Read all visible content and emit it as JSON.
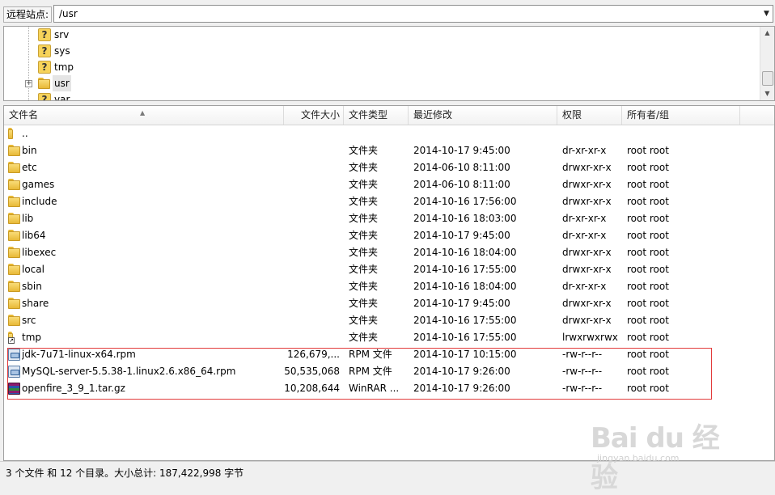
{
  "site_bar": {
    "label": "远程站点:",
    "path": "/usr"
  },
  "tree": {
    "items": [
      {
        "label": "srv",
        "icon": "question-folder-icon",
        "expandable": false
      },
      {
        "label": "sys",
        "icon": "question-folder-icon",
        "expandable": false
      },
      {
        "label": "tmp",
        "icon": "question-folder-icon",
        "expandable": false
      },
      {
        "label": "usr",
        "icon": "folder-icon",
        "expandable": true,
        "selected": true
      },
      {
        "label": "var",
        "icon": "question-folder-icon",
        "expandable": false
      }
    ]
  },
  "file_list": {
    "columns": {
      "name": "文件名",
      "size": "文件大小",
      "type": "文件类型",
      "modified": "最近修改",
      "permissions": "权限",
      "owner": "所有者/组"
    },
    "rows": [
      {
        "name": "..",
        "size": "",
        "type": "",
        "modified": "",
        "permissions": "",
        "owner": "",
        "icon": "folder-icon"
      },
      {
        "name": "bin",
        "size": "",
        "type": "文件夹",
        "modified": "2014-10-17 9:45:00",
        "permissions": "dr-xr-xr-x",
        "owner": "root root",
        "icon": "folder-icon"
      },
      {
        "name": "etc",
        "size": "",
        "type": "文件夹",
        "modified": "2014-06-10 8:11:00",
        "permissions": "drwxr-xr-x",
        "owner": "root root",
        "icon": "folder-icon"
      },
      {
        "name": "games",
        "size": "",
        "type": "文件夹",
        "modified": "2014-06-10 8:11:00",
        "permissions": "drwxr-xr-x",
        "owner": "root root",
        "icon": "folder-icon"
      },
      {
        "name": "include",
        "size": "",
        "type": "文件夹",
        "modified": "2014-10-16 17:56:00",
        "permissions": "drwxr-xr-x",
        "owner": "root root",
        "icon": "folder-icon"
      },
      {
        "name": "lib",
        "size": "",
        "type": "文件夹",
        "modified": "2014-10-16 18:03:00",
        "permissions": "dr-xr-xr-x",
        "owner": "root root",
        "icon": "folder-icon"
      },
      {
        "name": "lib64",
        "size": "",
        "type": "文件夹",
        "modified": "2014-10-17 9:45:00",
        "permissions": "dr-xr-xr-x",
        "owner": "root root",
        "icon": "folder-icon"
      },
      {
        "name": "libexec",
        "size": "",
        "type": "文件夹",
        "modified": "2014-10-16 18:04:00",
        "permissions": "drwxr-xr-x",
        "owner": "root root",
        "icon": "folder-icon"
      },
      {
        "name": "local",
        "size": "",
        "type": "文件夹",
        "modified": "2014-10-16 17:55:00",
        "permissions": "drwxr-xr-x",
        "owner": "root root",
        "icon": "folder-icon"
      },
      {
        "name": "sbin",
        "size": "",
        "type": "文件夹",
        "modified": "2014-10-16 18:04:00",
        "permissions": "dr-xr-xr-x",
        "owner": "root root",
        "icon": "folder-icon"
      },
      {
        "name": "share",
        "size": "",
        "type": "文件夹",
        "modified": "2014-10-17 9:45:00",
        "permissions": "drwxr-xr-x",
        "owner": "root root",
        "icon": "folder-icon"
      },
      {
        "name": "src",
        "size": "",
        "type": "文件夹",
        "modified": "2014-10-16 17:55:00",
        "permissions": "drwxr-xr-x",
        "owner": "root root",
        "icon": "folder-icon"
      },
      {
        "name": "tmp",
        "size": "",
        "type": "文件夹",
        "modified": "2014-10-16 17:55:00",
        "permissions": "lrwxrwxrwx",
        "owner": "root root",
        "icon": "folder-link-icon"
      },
      {
        "name": "jdk-7u71-linux-x64.rpm",
        "size": "126,679,...",
        "type": "RPM 文件",
        "modified": "2014-10-17 10:15:00",
        "permissions": "-rw-r--r--",
        "owner": "root root",
        "icon": "rpm-file-icon"
      },
      {
        "name": "MySQL-server-5.5.38-1.linux2.6.x86_64.rpm",
        "size": "50,535,068",
        "type": "RPM 文件",
        "modified": "2014-10-17 9:26:00",
        "permissions": "-rw-r--r--",
        "owner": "root root",
        "icon": "rpm-file-icon"
      },
      {
        "name": "openfire_3_9_1.tar.gz",
        "size": "10,208,644",
        "type": "WinRAR ...",
        "modified": "2014-10-17 9:26:00",
        "permissions": "-rw-r--r--",
        "owner": "root root",
        "icon": "rar-archive-icon"
      }
    ]
  },
  "status": {
    "text": "3 个文件 和 12 个目录。大小总计: 187,422,998 字节"
  },
  "watermark": {
    "logo": "Bai du 经验",
    "url": "jingyan.baidu.com"
  },
  "colors": {
    "highlight_border": "#e23b3b",
    "folder": "#e8b937",
    "panel_background": "#ffffff",
    "chrome_background": "#f0f0f0"
  }
}
